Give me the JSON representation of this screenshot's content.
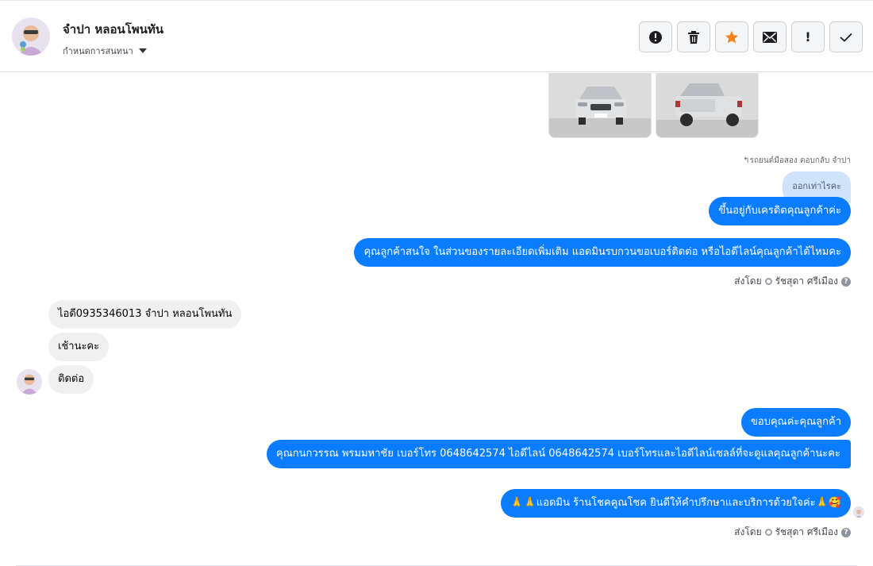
{
  "header": {
    "contact_name": "จำปา หลอนโพนทัน",
    "assign_label": "กำหนดการสนทนา",
    "actions": [
      {
        "name": "spam",
        "icon": "alert-circle-icon"
      },
      {
        "name": "delete",
        "icon": "trash-icon"
      },
      {
        "name": "star",
        "icon": "star-icon",
        "color": "#f5821f"
      },
      {
        "name": "mark-unread",
        "icon": "envelope-icon"
      },
      {
        "name": "follow-up",
        "icon": "exclamation-icon",
        "text": "!"
      },
      {
        "name": "done",
        "icon": "check-icon"
      }
    ]
  },
  "thread": {
    "reply_context": "↰รถยนต์มือสอง ตอบกลับ จำปา",
    "quoted_text": "ออกเท่าไรคะ",
    "messages": [
      {
        "from": "page",
        "text": "ขึ้นอยู่กับเครดิตคุณลูกค้าค่ะ"
      },
      {
        "from": "page",
        "text": "คุณลูกค้าสนใจ ในส่วนของรายละเอียดเพิ่มเติม แอดมินรบกวนขอเบอร์ติดต่อ หรือไอดีไลน์คุณลูกค้าได้ไหมคะ"
      },
      {
        "from": "customer",
        "text": "ไอดี0935346013  จำปา   หลอนโพนทัน"
      },
      {
        "from": "customer",
        "text": "เช้านะคะ"
      },
      {
        "from": "customer",
        "text": "ติดต่อ"
      },
      {
        "from": "page",
        "text": "ขอบคุณค่ะคุณลูกค้า"
      },
      {
        "from": "page",
        "text": "คุณกนกวรรณ พรมมหาชัย      เบอร์โทร 0648642574  ไอดีไลน์ 0648642574   เบอร์โทรและไอดีไลน์เซลล์ที่จะดูแลคุณลูกค้านะคะ"
      },
      {
        "from": "page",
        "text": "🙏🙏แอดมิน ร้านโชคคูณโชค ยินดีให้คำปรึกษาและบริการด้วยใจค่ะ🙏🥰"
      }
    ],
    "sent_by_label": "ส่งโดย",
    "sent_by_name": "รัชสุดา ศรีเมือง"
  },
  "colors": {
    "outgoing_bubble": "#0a7cff",
    "incoming_bubble": "#f0f0f0",
    "quoted_bubble": "#cfe3fb",
    "star": "#f5821f"
  }
}
